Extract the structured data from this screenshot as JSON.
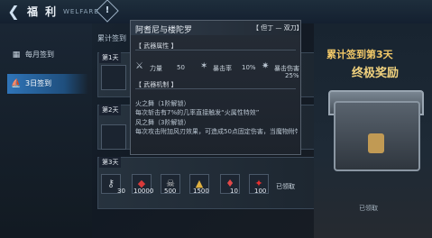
{
  "header": {
    "title": "福 利",
    "title_en": "WELFARE",
    "help_icon": "!"
  },
  "sidebar": {
    "items": [
      {
        "label": "每月签到",
        "icon": "calendar-icon"
      },
      {
        "label": "3日签到",
        "icon": "boat-icon",
        "active": true
      }
    ]
  },
  "main": {
    "title": "累计签到",
    "rows": [
      {
        "label": "第1天"
      },
      {
        "label": "第2天"
      },
      {
        "label": "第3天",
        "rewards": [
          {
            "icon": "key-icon",
            "count": "30"
          },
          {
            "icon": "red-crystal-icon",
            "count": "10000"
          },
          {
            "icon": "skull-coin-icon",
            "count": "500"
          },
          {
            "icon": "gold-icon",
            "count": "1500"
          },
          {
            "icon": "red-potion-icon",
            "count": "10"
          },
          {
            "icon": "red-gem-icon",
            "count": "100"
          }
        ],
        "status": "已领取"
      }
    ]
  },
  "banner": {
    "title": "累计签到第3天",
    "subtitle": "终极奖励",
    "claimed": "已领取"
  },
  "tooltip": {
    "name": "阿耆尼与楼陀罗",
    "type": "【 但丁 — 双刀】",
    "sec_attr": "【 武器属性 】",
    "stats": [
      {
        "icon": "sword-icon",
        "label": "力量",
        "value": "50"
      },
      {
        "icon": "crit-icon",
        "label": "暴击率",
        "value": "10%"
      },
      {
        "icon": "crit-damage-icon",
        "label": "暴击伤害",
        "value": "25%"
      }
    ],
    "sec_mech": "【 武器机制 】",
    "desc": [
      "火之舞（1阶解锁）",
      "每次斩击有7%的几率直接触发“火属性特效”",
      "风之舞（3阶解锁）",
      "每次攻击附加风刃效果，可造成50点固定伤害，当魔物附带风"
    ]
  },
  "colors": {
    "accent": "#2f74b8",
    "gold": "#f3c968",
    "panel": "#252c36"
  }
}
